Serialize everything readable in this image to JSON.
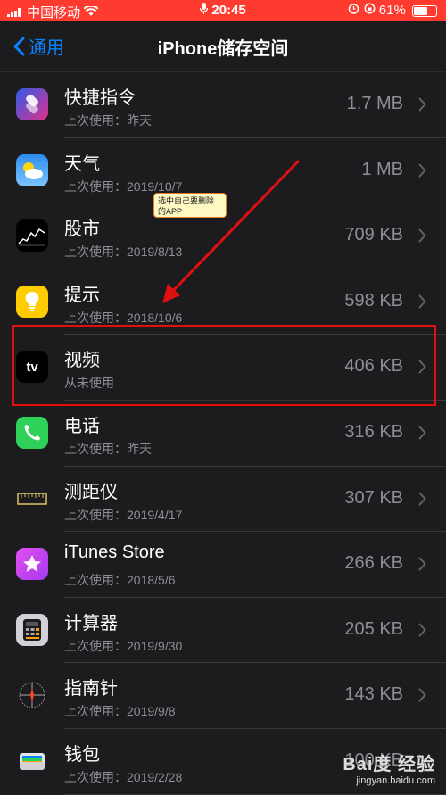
{
  "status": {
    "carrier": "中国移动",
    "time": "20:45",
    "battery": "61%",
    "battery_level": 0.61
  },
  "nav": {
    "back_label": "通用",
    "title": "iPhone储存空间"
  },
  "apps": [
    {
      "name": "快捷指令",
      "last_used": "上次使用：昨天",
      "size": "1.7 MB",
      "icon": "shortcuts-icon"
    },
    {
      "name": "天气",
      "last_used": "上次使用：2019/10/7",
      "size": "1 MB",
      "icon": "weather-icon"
    },
    {
      "name": "股市",
      "last_used": "上次使用：2019/8/13",
      "size": "709 KB",
      "icon": "stocks-icon"
    },
    {
      "name": "提示",
      "last_used": "上次使用：2018/10/6",
      "size": "598 KB",
      "icon": "tips-icon"
    },
    {
      "name": "视频",
      "last_used": "从未使用",
      "size": "406 KB",
      "icon": "tv-icon",
      "icon_text": "tv"
    },
    {
      "name": "电话",
      "last_used": "上次使用：昨天",
      "size": "316 KB",
      "icon": "phone-icon"
    },
    {
      "name": "测距仪",
      "last_used": "上次使用：2019/4/17",
      "size": "307 KB",
      "icon": "measure-icon"
    },
    {
      "name": "iTunes Store",
      "last_used": "上次使用：2018/5/6",
      "size": "266 KB",
      "icon": "itunes-star-icon"
    },
    {
      "name": "计算器",
      "last_used": "上次使用：2019/9/30",
      "size": "205 KB",
      "icon": "calculator-icon"
    },
    {
      "name": "指南针",
      "last_used": "上次使用：2019/9/8",
      "size": "143 KB",
      "icon": "compass-icon"
    },
    {
      "name": "钱包",
      "last_used": "上次使用：2019/2/28",
      "size": "100 KB",
      "icon": "wallet-icon"
    }
  ],
  "annotation": {
    "line1": "选中自己要删除",
    "line2": "的APP"
  },
  "watermark": {
    "brand": "Bai度 经验",
    "url": "jingyan.baidu.com"
  },
  "colors": {
    "background": "#1c1c1e",
    "status_bar": "#ff3b30",
    "link": "#0a84ff",
    "highlight": "#e01010"
  }
}
